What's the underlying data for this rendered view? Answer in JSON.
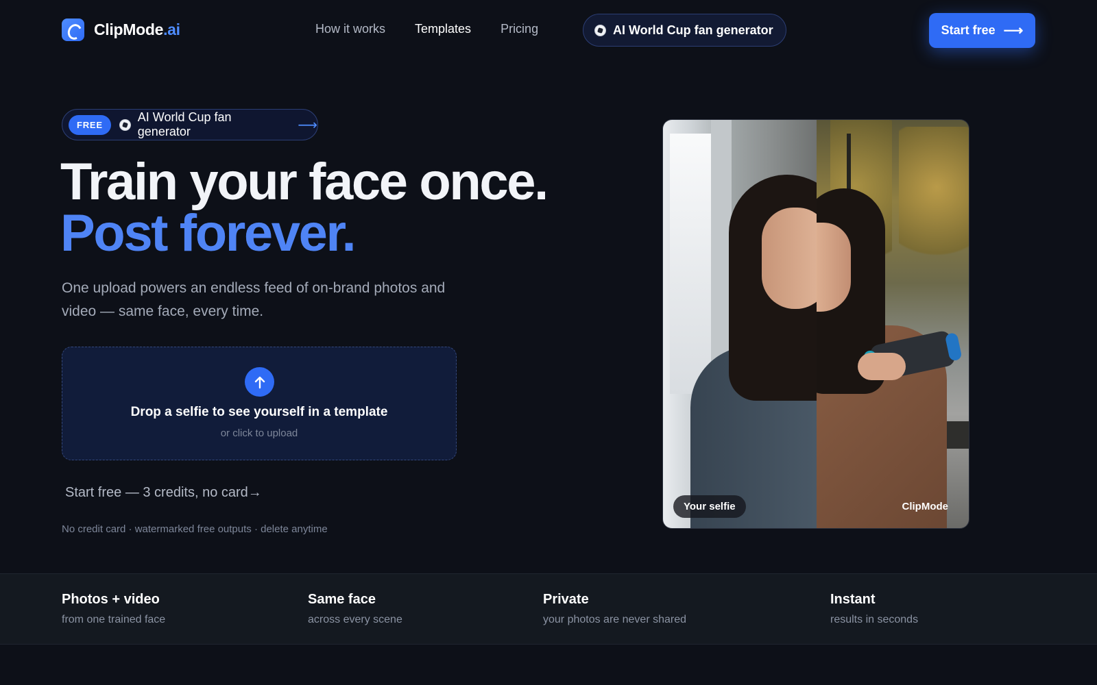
{
  "brand": {
    "name": "ClipMode",
    "suffix": ".ai"
  },
  "nav": {
    "links": [
      "How it works",
      "Templates",
      "Pricing"
    ],
    "active_link": "Templates",
    "pill_label": "AI World Cup fan generator",
    "cta_label": "Start free"
  },
  "hero": {
    "badge": {
      "tag": "FREE",
      "label": "AI World Cup fan generator"
    },
    "headline_line1": "Train your face once.",
    "headline_line2": "Post forever.",
    "subheadline": "One upload powers an endless feed of on-brand photos and video — same face, every time.",
    "dropzone": {
      "title": "Drop a selfie to see yourself in a template",
      "subtitle": "or click to upload"
    },
    "start_link": "Start free — 3 credits, no card→",
    "fineprint": "No credit card · watermarked free outputs · delete anytime"
  },
  "comparison": {
    "left_label": "Your selfie",
    "right_label": "ClipMode"
  },
  "features": [
    {
      "title": "Photos + video",
      "subtitle": "from one trained face"
    },
    {
      "title": "Same face",
      "subtitle": "across every scene"
    },
    {
      "title": "Private",
      "subtitle": "your photos are never shared"
    },
    {
      "title": "Instant",
      "subtitle": "results in seconds"
    }
  ],
  "colors": {
    "background": "#0d1018",
    "accent": "#2f6bf5",
    "accent_text": "#4f84f5"
  }
}
